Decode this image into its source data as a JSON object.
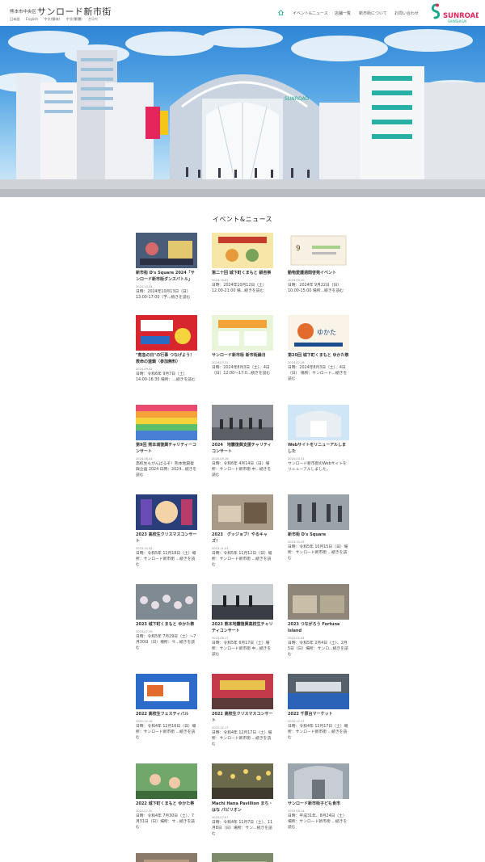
{
  "header": {
    "subtitle": "熊本市中央区",
    "title": "サンロード新市街",
    "languages": [
      "日本語",
      "English",
      "中文(簡体)",
      "中文(繁體)",
      "한국어"
    ],
    "nav": [
      "イベント&ニュース",
      "店舗一覧",
      "新市街について",
      "お問い合わせ"
    ],
    "logo_main": "SUNROAD",
    "logo_sub": "SHINSHIGAI"
  },
  "hero": {
    "banner_text": "SUNROAD",
    "dots": 3,
    "active_dot": 0,
    "colors": {
      "dot_active": "#e8475d",
      "dot_inactive": "#27b0a3"
    }
  },
  "section": {
    "title": "イベント&ニュース"
  },
  "colors": {
    "brand_green": "#19a78b",
    "brand_pink": "#e4265c"
  },
  "news": [
    {
      "title": "新市街 D's Square 2024「サンロード新市街ダンスバトル」",
      "date": "2024.10.04",
      "excerpt": "日時：2024年10月13日（日）13:00-17:00（予...続きを読む",
      "thumb": "dance"
    },
    {
      "title": "第二十回 城下町くまもと 銀杏祭",
      "date": "2024.10.02",
      "excerpt": "日時：2024年10月12日（土）12:00-21:00 場...続きを読む",
      "thumb": "poster-ginnan"
    },
    {
      "title": "動物愛護週間啓発イベント",
      "date": "2024.09.20",
      "excerpt": "日時：2024年 9月22日（日）10:00-15:00 場所...続きを読む",
      "thumb": "poster-animal"
    },
    {
      "title": "\"救急の日\"の行事 つなげよう！救命の連鎖（参加無料）",
      "date": "2024.09.03",
      "excerpt": "日時：令和6年 9月7日（土）14:00-16:30 場所：...続きを読む",
      "thumb": "poster-red"
    },
    {
      "title": "サンロード新市街 新市街縁日",
      "date": "2024.07.31",
      "excerpt": "日時：2024年8月3日（土）、4日（日）12:00～17:0...続きを読む",
      "thumb": "poster-ennichi"
    },
    {
      "title": "第20回 城下町くまもと ゆかた祭",
      "date": "2024.07.18",
      "excerpt": "日時：2024年8月3日（土）、4日（日） 場所：サンロード...続きを読む",
      "thumb": "poster-yukata"
    },
    {
      "title": "第9回 熊本城復興チャリティーコンサート",
      "date": "2024.06.03",
      "excerpt": "高校生もがんばるぞ！熊本地震復興企画 2024 日時：2024...続きを読む",
      "thumb": "poster-rainbow"
    },
    {
      "title": "2024　地震復興支援チャリティコンサート",
      "date": "2024.05.16",
      "excerpt": "日時：令和6年 4月14日（日）場所：サンロード新市街 中...続きを読む",
      "thumb": "concert"
    },
    {
      "title": "Webサイトをリニューアルしました",
      "date": "2024.03.31",
      "excerpt": "サンロード新市街のWebサイトをリニューアルしました。",
      "thumb": "arcade"
    },
    {
      "title": "2023 高校生クリスマスコンサート",
      "date": "2023.12.05",
      "excerpt": "日時：令和5年 12月18日（土）場所：サンロード新市街 ...続きを読む",
      "thumb": "poster-xmas"
    },
    {
      "title": "2023　グッジョブ！やるキャズ！",
      "date": "2023.11.02",
      "excerpt": "日時：令和5年 11月12日（日）場所：サンロード新市街 ...続きを読む",
      "thumb": "crafts"
    },
    {
      "title": "新市街 D's Square",
      "date": "2023.10.25",
      "excerpt": "日時：令和5年 10月15日（日）場所：サンロード新市街 ...続きを読む",
      "thumb": "dance2"
    },
    {
      "title": "2023 城下町くまもと ゆかた祭",
      "date": "2023.07.29",
      "excerpt": "日時：令和5年 7月29日（土）～7月30日（日）場所：サ...続きを読む",
      "thumb": "crowd"
    },
    {
      "title": "2023 熊本地震復興高校生チャリティコンサート",
      "date": "2023.06.17",
      "excerpt": "日時：令和5年 6月17日（土）場所：サンロード新市街 中...続きを読む",
      "thumb": "concert2"
    },
    {
      "title": "2023 つながろう Fortune Island",
      "date": "2023.02.04",
      "excerpt": "日時：令和5年 2月4日（土）、2月5日（日）場所：サンロ...続きを読む",
      "thumb": "stalls"
    },
    {
      "title": "2022 高校生フェスティバル",
      "date": "2022.12.16",
      "excerpt": "日時：令和4年 12月16日（日）場所：サンロード新市街 ...続きを読む",
      "thumb": "painting"
    },
    {
      "title": "2022 高校生クリスマスコンサート",
      "date": "2022.12.17",
      "excerpt": "日時：令和4年 12月17日（土）場所：サンロード新市街 ...続きを読む",
      "thumb": "banner-stage"
    },
    {
      "title": "2022 千原台マーケット",
      "date": "2022.12.17",
      "excerpt": "日時：令和4年 12月17日（土）場所：サンロード新市街 ...続きを読む",
      "thumb": "market"
    },
    {
      "title": "2022 城下町くまもと ゆかた祭",
      "date": "2022.07.30",
      "excerpt": "日時：令和4年 7月30日（土）、7月31日（日）場所：サ...続きを読む",
      "thumb": "kids"
    },
    {
      "title": "Machi Hana Pavillion まち・はな パビリオン",
      "date": "2022.07.07",
      "excerpt": "日時：令和4年 11月7日（土）、11月8日（日）場所：サン...続きを読む",
      "thumb": "flowers"
    },
    {
      "title": "サンロード新市街子ども食市",
      "date": "2019.08.24",
      "excerpt": "日時：平成31年、8月24日（土）場所：サンロード新市街 ...続きを読む",
      "thumb": "arcade2"
    },
    {
      "title": "",
      "date": "",
      "excerpt": "",
      "thumb": "partial1"
    },
    {
      "title": "",
      "date": "",
      "excerpt": "",
      "thumb": "partial2"
    }
  ]
}
